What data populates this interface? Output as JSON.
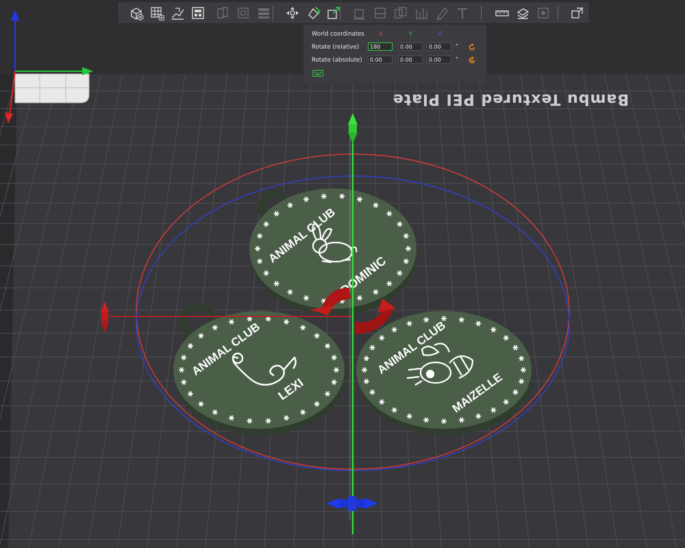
{
  "toolbar": {
    "buttons": [
      {
        "name": "add-object-button",
        "icon": "add-cube-icon",
        "enabled": true
      },
      {
        "name": "add-plate-button",
        "icon": "add-plate-grid-icon",
        "enabled": true
      },
      {
        "name": "auto-orient-button",
        "icon": "auto-orient-icon",
        "enabled": true
      },
      {
        "name": "arrange-button",
        "icon": "arrange-icon",
        "enabled": true
      },
      {
        "name": "split-objects-button",
        "icon": "split-objects-icon",
        "enabled": false
      },
      {
        "name": "split-parts-button",
        "icon": "split-parts-icon",
        "enabled": false
      },
      {
        "name": "layers-button",
        "icon": "layers-icon",
        "enabled": false
      },
      {
        "name": "move-button",
        "icon": "move-icon",
        "enabled": true
      },
      {
        "name": "rotate-button",
        "icon": "rotate-icon",
        "enabled": true,
        "active": true
      },
      {
        "name": "scale-button",
        "icon": "scale-icon",
        "enabled": true
      },
      {
        "name": "lay-on-face-button",
        "icon": "lay-on-face-icon",
        "enabled": false
      },
      {
        "name": "cut-button",
        "icon": "cut-icon",
        "enabled": false
      },
      {
        "name": "mesh-boolean-button",
        "icon": "boolean-icon",
        "enabled": false
      },
      {
        "name": "support-paint-button",
        "icon": "support-paint-icon",
        "enabled": false
      },
      {
        "name": "seam-paint-button",
        "icon": "seam-paint-icon",
        "enabled": false
      },
      {
        "name": "text-button",
        "icon": "text-icon",
        "enabled": false
      },
      {
        "name": "measure-button",
        "icon": "ruler-icon",
        "enabled": true
      },
      {
        "name": "assembly-button",
        "icon": "assembly-icon",
        "enabled": true
      },
      {
        "name": "emboss-button",
        "icon": "emboss-icon",
        "enabled": false
      },
      {
        "name": "variable-layer-button",
        "icon": "variable-layer-icon",
        "enabled": true
      }
    ]
  },
  "rotate_panel": {
    "coordinate_system": "World coordinates",
    "axes": [
      "X",
      "Y",
      "Z"
    ],
    "axis_colors": {
      "X": "#e5463e",
      "Y": "#3fbf54",
      "Z": "#4a62e8"
    },
    "rows": [
      {
        "label": "Rotate (relative)",
        "values": [
          "180",
          "0.00",
          "0.00"
        ],
        "unit": "°",
        "reset_icon": "rotate-reset-icon"
      },
      {
        "label": "Rotate (absolute)",
        "values": [
          "0.00",
          "0.00",
          "0.00"
        ],
        "unit": "°",
        "reset_icon": "rotate-absolute-reset-icon"
      }
    ],
    "footer_icon": "keyboard-shortcut-icon"
  },
  "plate": {
    "name": "Bambu Textured PEI Plate",
    "grid_color": "#4f4f53",
    "bed_color": "#38383c"
  },
  "tags": [
    {
      "club": "ANIMAL CLUB",
      "name": "DOMINIC",
      "animal": "rabbit-icon"
    },
    {
      "club": "ANIMAL CLUB",
      "name": "LEXI",
      "animal": "snake-icon"
    },
    {
      "club": "ANIMAL CLUB",
      "name": "MAIZELLE",
      "animal": "bee-icon"
    }
  ],
  "colors": {
    "tag_fill": "#4b5e48",
    "tag_edge": "#2f3c2e",
    "selection_ring": "#d93a3a",
    "z_ring": "#3340cf",
    "gizmo_red": "#c81d1d",
    "gizmo_green": "#35e13b",
    "gizmo_blue": "#1e3bea"
  }
}
